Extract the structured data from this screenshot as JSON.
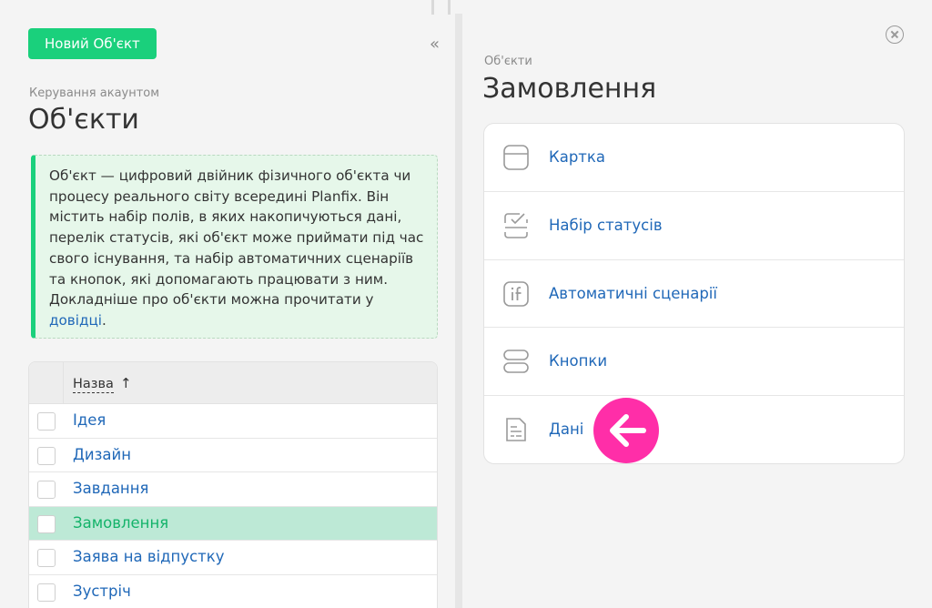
{
  "left": {
    "new_button": "Новий Об'єкт",
    "collapse_glyph": "«",
    "breadcrumb": "Керування акаунтом",
    "title": "Об'єкти",
    "info": {
      "text": "Об'єкт — цифровий двійник фізичного об'єкта чи процесу реального світу всередині Planfix. Він містить набір полів, в яких накопичуються дані, перелік статусів, які об'єкт може приймати під час свого існування, та набір автоматичних сценаріїв та кнопок, які допомагають працювати з ним. Докладніше про об'єкти можна прочитати у ",
      "link": "довідці",
      "tail": "."
    },
    "table": {
      "header": "Назва",
      "sort_glyph": "↑",
      "rows": [
        {
          "name": "Ідея"
        },
        {
          "name": "Дизайн"
        },
        {
          "name": "Завдання"
        },
        {
          "name": "Замовлення",
          "selected": true
        },
        {
          "name": "Заява на відпустку"
        },
        {
          "name": "Зустріч"
        }
      ]
    }
  },
  "right": {
    "label": "Об'єкти",
    "title": "Замовлення",
    "menu": [
      {
        "label": "Картка",
        "icon": "card-icon"
      },
      {
        "label": "Набір статусів",
        "icon": "status-set-icon"
      },
      {
        "label": "Автоматичні сценарії",
        "icon": "scenario-if-icon"
      },
      {
        "label": "Кнопки",
        "icon": "buttons-icon"
      },
      {
        "label": "Дані",
        "icon": "data-document-icon"
      }
    ]
  },
  "colors": {
    "accent_green": "#1ad07c",
    "link_blue": "#2068b8",
    "selected_row": "#bde9d6",
    "info_bg": "#e6f7ea",
    "pointer_pink": "#ff2ea8"
  }
}
